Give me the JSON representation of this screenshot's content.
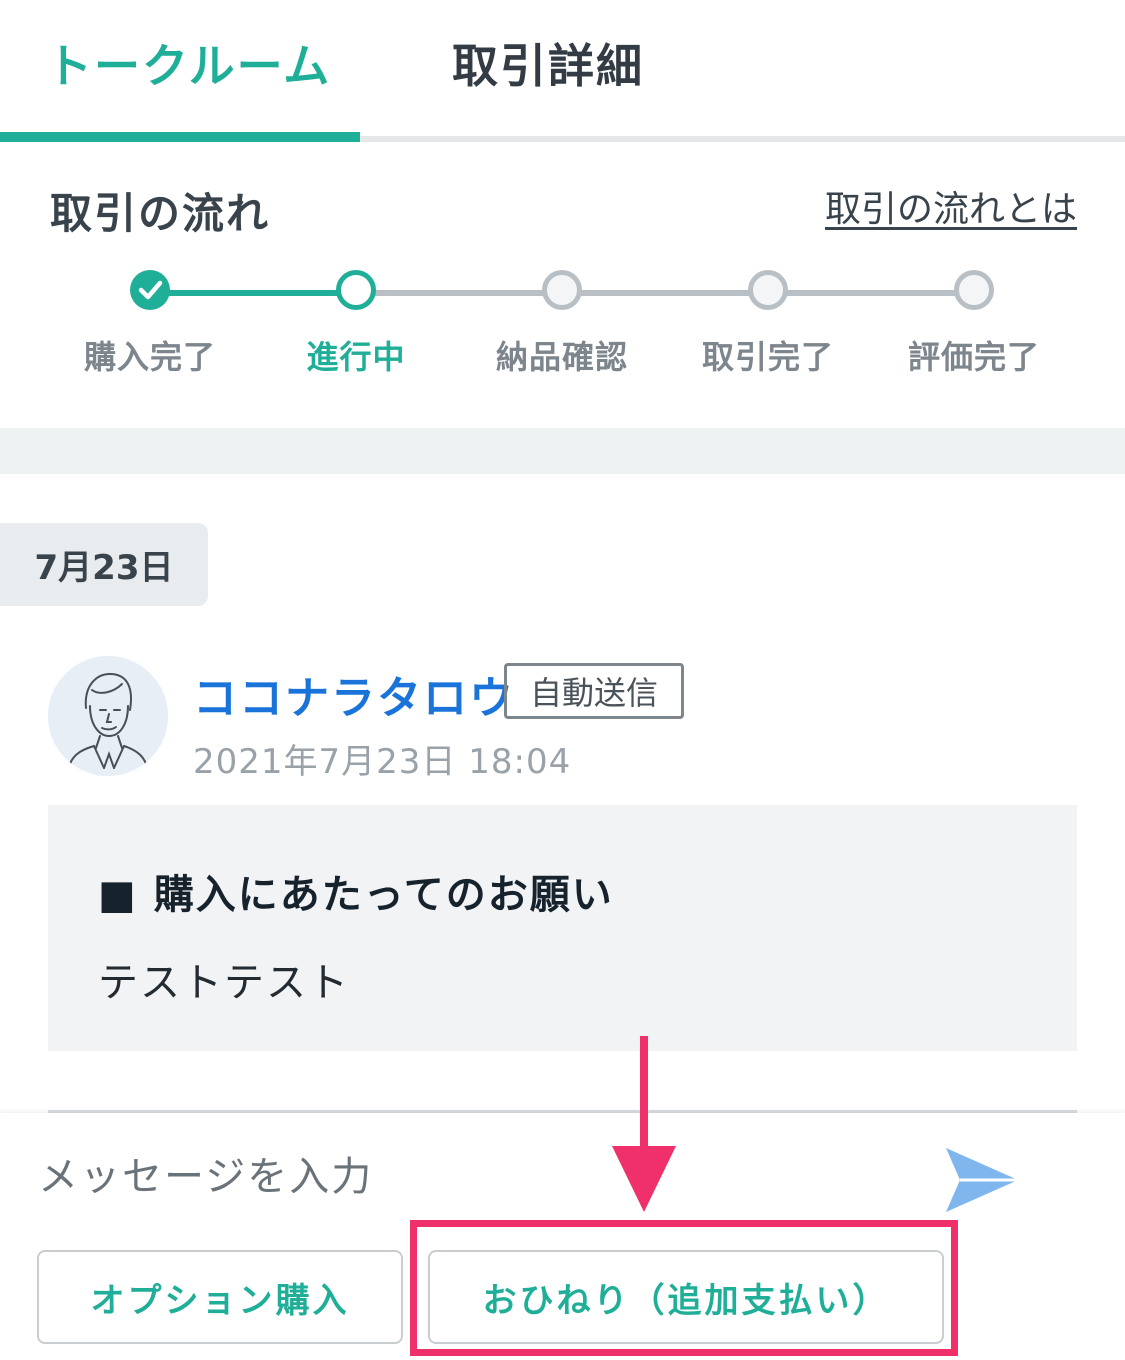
{
  "tabs": {
    "talk_room": "トークルーム",
    "details": "取引詳細"
  },
  "flow": {
    "title": "取引の流れ",
    "help_link": "取引の流れとは",
    "steps": [
      {
        "label": "購入完了",
        "state": "done"
      },
      {
        "label": "進行中",
        "state": "current"
      },
      {
        "label": "納品確認",
        "state": "todo"
      },
      {
        "label": "取引完了",
        "state": "todo"
      },
      {
        "label": "評価完了",
        "state": "todo"
      }
    ]
  },
  "chat": {
    "date_chip": "7月23日",
    "message": {
      "sender": "ココナラタロウ",
      "badge": "自動送信",
      "timestamp": "2021年7月23日 18:04",
      "heading": "■ 購入にあたってのお願い",
      "body": "テストテスト"
    }
  },
  "composer": {
    "placeholder": "メッセージを入力",
    "option_button": "オプション購入",
    "tip_button": "おひねり（追加支払い）"
  },
  "colors": {
    "accent": "#1fae98",
    "sender": "#1a73d9",
    "annotation": "#f0306a",
    "send_icon": "#7fb6ee"
  },
  "icons": {
    "check": "check-icon",
    "send": "send-icon",
    "annotation_arrow": "arrow-down-icon"
  }
}
